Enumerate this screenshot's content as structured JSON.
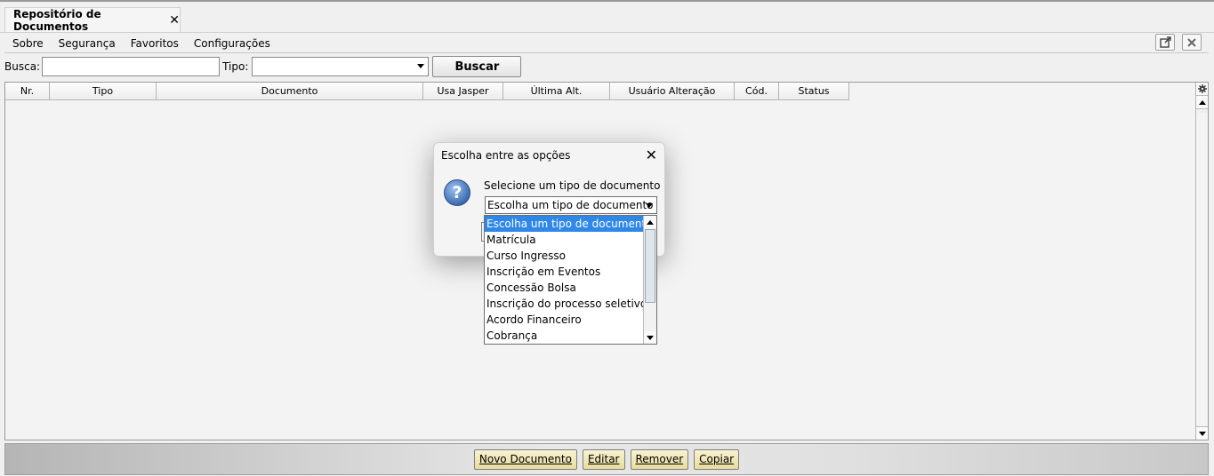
{
  "tab": {
    "title": "Repositório de Documentos",
    "close": "✕"
  },
  "menu": [
    "Sobre",
    "Segurança",
    "Favoritos",
    "Configurações"
  ],
  "window_icons": [
    "external-link-icon",
    "close-icon"
  ],
  "search": {
    "busca_label": "Busca:",
    "busca_value": "",
    "tipo_label": "Tipo:",
    "tipo_value": "",
    "buscar_label": "Buscar"
  },
  "table": {
    "columns": [
      "Nr.",
      "Tipo",
      "Documento",
      "Usa Jasper",
      "Última Alt.",
      "Usuário Alteração",
      "Cód.",
      "Status"
    ],
    "rows": []
  },
  "actions": [
    "Novo Documento",
    "Editar",
    "Remover",
    "Copiar"
  ],
  "dialog": {
    "title": "Escolha entre as opções",
    "close": "✕",
    "prompt": "Selecione um tipo de documento",
    "selected": "Escolha um tipo de documento",
    "options": [
      "Escolha um tipo de documento",
      "Matrícula",
      "Curso Ingresso",
      "Inscrição em Eventos",
      "Concessão Bolsa",
      "Inscrição do processo seletivo",
      "Acordo Financeiro",
      "Cobrança"
    ],
    "highlight_color": "#2f88e8"
  }
}
